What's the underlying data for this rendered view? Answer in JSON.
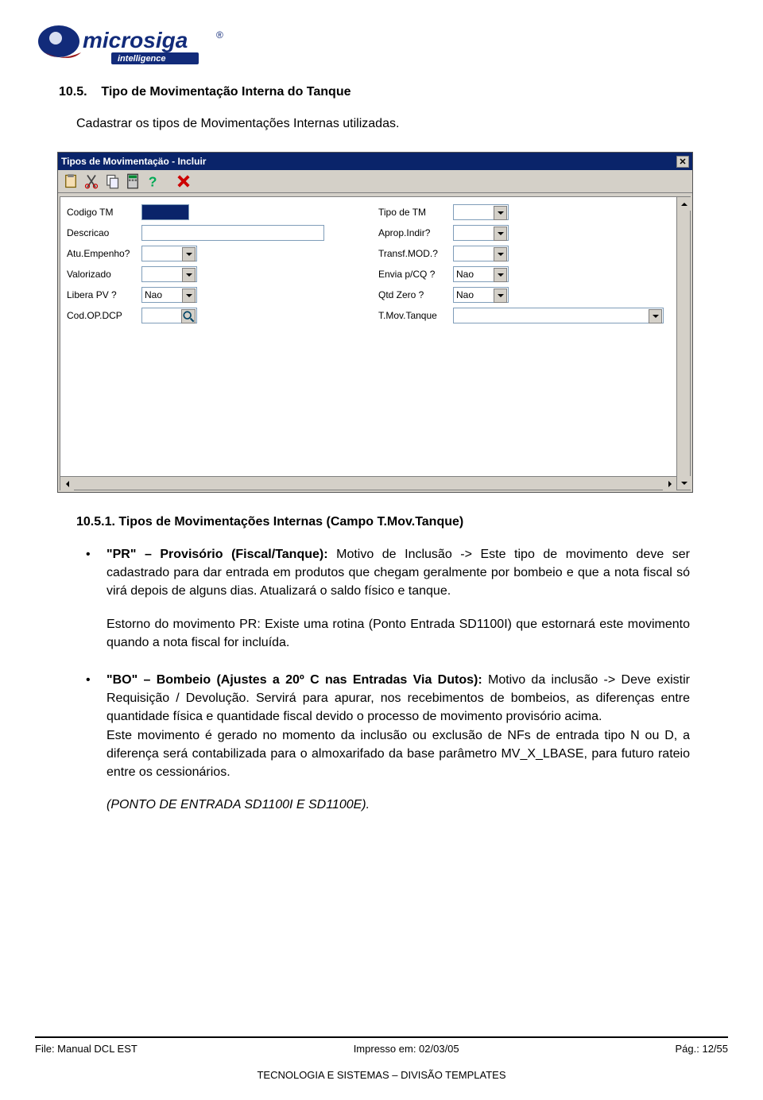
{
  "logo": {
    "name": "microsiga",
    "sub": "intelligence"
  },
  "section": {
    "num": "10.5.",
    "title": "Tipo de Movimentação Interna do Tanque",
    "intro": "Cadastrar os tipos de Movimentações Internas utilizadas."
  },
  "window": {
    "title": "Tipos de Movimentaçäo - Incluir",
    "toolbar_icons": [
      "paste-icon",
      "cut-icon",
      "copy-icon",
      "calc-icon",
      "help-icon",
      "close-icon"
    ],
    "labels": {
      "codigo_tm": "Codigo TM",
      "tipo_tm": "Tipo de TM",
      "descricao": "Descricao",
      "aprop_indir": "Aprop.Indir?",
      "atu_empenho": "Atu.Empenho?",
      "transf_mod": "Transf.MOD.?",
      "valorizado": "Valorizado",
      "envia_cq": "Envia p/CQ ?",
      "envia_cq_val": "Nao",
      "libera_pv": "Libera PV  ?",
      "libera_pv_val": "Nao",
      "qtd_zero": "Qtd Zero   ?",
      "qtd_zero_val": "Nao",
      "cod_op_dcp": "Cod.OP.DCP",
      "t_mov_tanque": "T.Mov.Tanque"
    }
  },
  "subsection": {
    "full": "10.5.1. Tipos de Movimentações Internas  (Campo T.Mov.Tanque)"
  },
  "bullets": [
    {
      "lead": "\"PR\" – Provisório  (Fiscal/Tanque): ",
      "body": "  Motivo de Inclusão -> Este tipo de movimento deve ser cadastrado para dar entrada em produtos que chegam geralmente por bombeio e que a nota fiscal só virá depois de alguns dias. Atualizará o saldo físico e tanque.",
      "extra": "Estorno do movimento PR: Existe uma rotina (Ponto Entrada SD1100I) que estornará este movimento quando a nota fiscal for incluída."
    },
    {
      "lead": "\"BO\" – Bombeio (Ajustes a 20º C nas Entradas Via Dutos): ",
      "body": " Motivo da inclusão -> Deve existir Requisição / Devolução. Servirá para apurar, nos recebimentos de bombeios, as diferenças entre quantidade física e quantidade fiscal devido o processo de movimento provisório acima.",
      "extra2": "Este movimento é gerado no momento da inclusão ou exclusão de NFs de entrada tipo N ou D, a diferença será contabilizada para o almoxarifado da base parâmetro MV_X_LBASE, para futuro rateio entre os cessionários.",
      "note": "(PONTO DE ENTRADA SD1100I E SD1100E)."
    }
  ],
  "footer": {
    "file": "File: Manual DCL EST",
    "printed": "Impresso em: 02/03/05",
    "page": "Pág.: 12/55",
    "dept": "TECNOLOGIA E SISTEMAS – DIVISÃO TEMPLATES"
  }
}
